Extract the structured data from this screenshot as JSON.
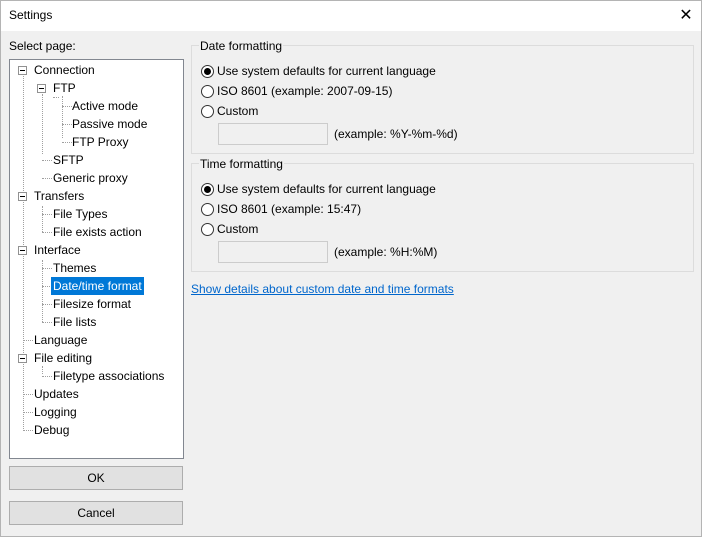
{
  "window": {
    "title": "Settings",
    "close_symbol": "✕"
  },
  "sidebar": {
    "label": "Select page:",
    "tree": [
      "Connection",
      "FTP",
      "Active mode",
      "Passive mode",
      "FTP Proxy",
      "SFTP",
      "Generic proxy",
      "Transfers",
      "File Types",
      "File exists action",
      "Interface",
      "Themes",
      "Date/time format",
      "Filesize format",
      "File lists",
      "Language",
      "File editing",
      "Filetype associations",
      "Updates",
      "Logging",
      "Debug"
    ],
    "selected": "Date/time format",
    "ok_label": "OK",
    "cancel_label": "Cancel"
  },
  "date_formatting": {
    "title": "Date formatting",
    "options": [
      "Use system defaults for current language",
      "ISO 8601 (example: 2007-09-15)",
      "Custom"
    ],
    "selected_index": 0,
    "custom_value": "",
    "custom_hint": "(example: %Y-%m-%d)"
  },
  "time_formatting": {
    "title": "Time formatting",
    "options": [
      "Use system defaults for current language",
      "ISO 8601 (example: 15:47)",
      "Custom"
    ],
    "selected_index": 0,
    "custom_value": "",
    "custom_hint": "(example: %H:%M)"
  },
  "details_link": "Show details about custom date and time formats",
  "colors": {
    "selection": "#0078d7",
    "link": "#0066cc",
    "background": "#f0f0f0"
  }
}
